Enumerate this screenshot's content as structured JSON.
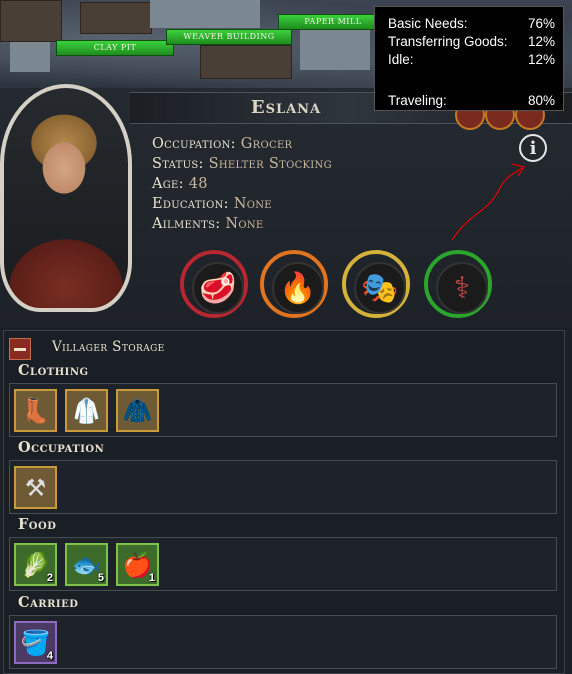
{
  "map_labels": [
    "Clay Pit",
    "Weaver Building",
    "Paper Mill"
  ],
  "tooltip": {
    "rows": [
      {
        "label": "Basic Needs:",
        "value": "76%"
      },
      {
        "label": "Transferring Goods:",
        "value": "12%"
      },
      {
        "label": "Idle:",
        "value": "12%"
      },
      {
        "label": "Traveling:",
        "value": "80%"
      }
    ]
  },
  "villager": {
    "name": "Eslana",
    "attributes": [
      {
        "label": "Occupation:",
        "value": "Grocer"
      },
      {
        "label": "Status:",
        "value": "Shelter Stocking"
      },
      {
        "label": "Age:",
        "value": "48"
      },
      {
        "label": "Education:",
        "value": "None"
      },
      {
        "label": "Ailments:",
        "value": "None"
      }
    ],
    "info_icon": "info-icon",
    "needs": [
      {
        "icon": "meat-icon",
        "color": "#b8262f"
      },
      {
        "icon": "fire-icon",
        "color": "#e0741f"
      },
      {
        "icon": "theater-masks-icon",
        "color": "#d4b23a"
      },
      {
        "icon": "caduceus-icon",
        "color": "#2ba52b"
      }
    ]
  },
  "storage": {
    "title": "Villager Storage",
    "categories": [
      {
        "label": "Clothing",
        "items": [
          {
            "icon": "boots-icon",
            "glyph": "👢",
            "count": ""
          },
          {
            "icon": "tunic-icon",
            "glyph": "🥼",
            "count": ""
          },
          {
            "icon": "coat-icon",
            "glyph": "🧥",
            "count": ""
          }
        ]
      },
      {
        "label": "Occupation",
        "items": [
          {
            "icon": "hammer-icon",
            "glyph": "⚒",
            "count": ""
          }
        ]
      },
      {
        "label": "Food",
        "items": [
          {
            "icon": "cabbage-icon",
            "glyph": "🥬",
            "count": "2"
          },
          {
            "icon": "fish-icon",
            "glyph": "🐟",
            "count": "5"
          },
          {
            "icon": "fruit-icon",
            "glyph": "🍎",
            "count": "1"
          }
        ]
      },
      {
        "label": "Carried",
        "items": [
          {
            "icon": "water-bucket-icon",
            "glyph": "🪣",
            "count": "4"
          }
        ]
      }
    ]
  }
}
